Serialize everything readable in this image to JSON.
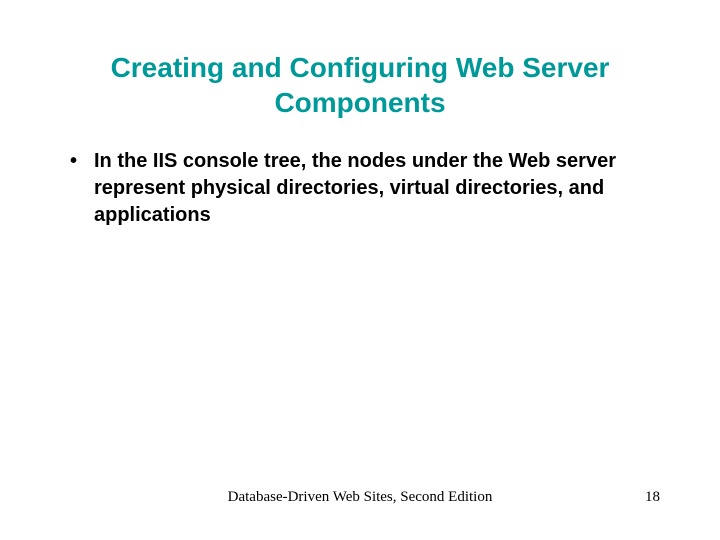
{
  "title": "Creating and Configuring Web Server Components",
  "bullets": [
    "In the IIS console tree, the nodes under the Web server represent physical directories, virtual directories, and applications"
  ],
  "footer": {
    "text": "Database-Driven Web Sites, Second Edition",
    "page": "18"
  }
}
